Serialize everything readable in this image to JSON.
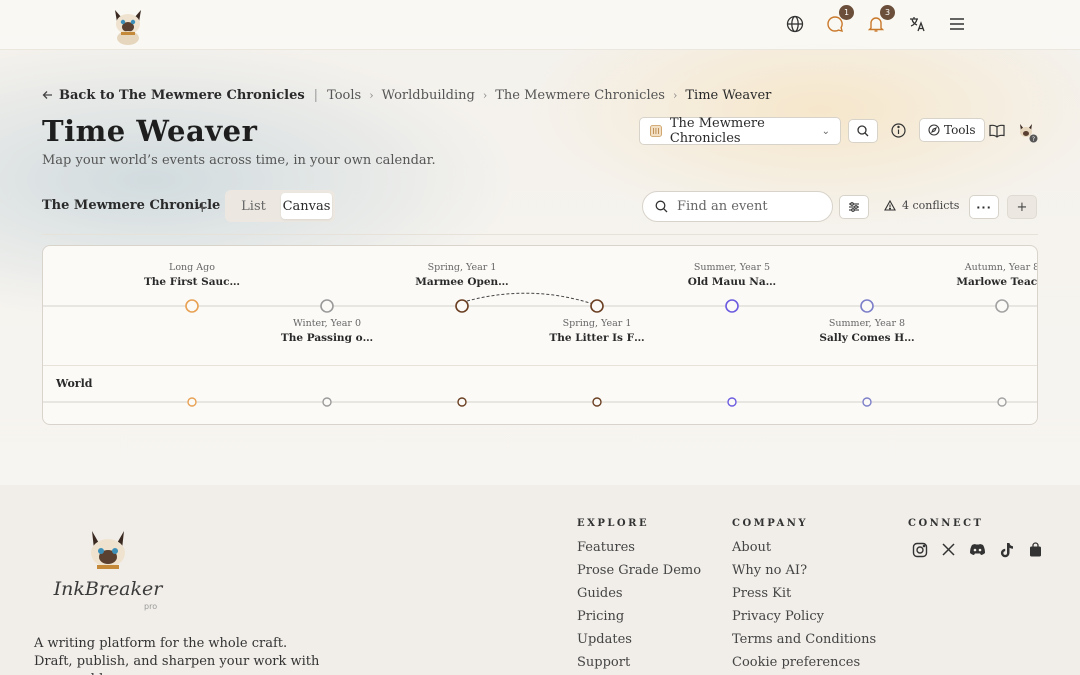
{
  "nav": {
    "messages_badge": "1",
    "notifications_badge": "3"
  },
  "breadcrumb": {
    "back_label": "Back to The Mewmere Chronicles",
    "items": [
      "Tools",
      "Worldbuilding",
      "The Mewmere Chronicles"
    ],
    "current": "Time Weaver"
  },
  "page": {
    "title": "Time Weaver",
    "subtitle": "Map your world’s events across time, in your own calendar."
  },
  "header": {
    "project_select": "The Mewmere Chronicles",
    "tools_label": "Tools"
  },
  "toolbar": {
    "chronicle_name": "The Mewmere Chronicle",
    "views": [
      "List",
      "Canvas"
    ],
    "active_view": "Canvas",
    "search_placeholder": "Find an event",
    "conflicts_label": "4 conflicts"
  },
  "timeline": {
    "lane_label": "World",
    "events": [
      {
        "date": "Long Ago",
        "title": "The First Sauc…",
        "row": "top",
        "color": "#e8a154"
      },
      {
        "date": "Winter, Year 0",
        "title": "The Passing o…",
        "row": "bottom",
        "color": "#9a9a9a"
      },
      {
        "date": "Spring, Year 1",
        "title": "Marmee Open…",
        "row": "top",
        "color": "#6b3f22"
      },
      {
        "date": "Spring, Year 1",
        "title": "The Litter Is F…",
        "row": "bottom",
        "color": "#6b3f22"
      },
      {
        "date": "Summer, Year 5",
        "title": "Old Mauu Na…",
        "row": "top",
        "color": "#6c5ce0"
      },
      {
        "date": "Summer, Year 8",
        "title": "Sally Comes H…",
        "row": "bottom",
        "color": "#7d7fc9"
      },
      {
        "date": "Autumn, Year 8",
        "title": "Marlowe Teac…",
        "row": "top",
        "color": "#a3a3a3"
      }
    ]
  },
  "footer": {
    "description": "A writing platform for the whole craft. Draft, publish, and sharpen your work with measurable",
    "explore": {
      "heading": "EXPLORE",
      "links": [
        "Features",
        "Prose Grade Demo",
        "Guides",
        "Pricing",
        "Updates",
        "Support"
      ]
    },
    "company": {
      "heading": "COMPANY",
      "links": [
        "About",
        "Why no AI?",
        "Press Kit",
        "Privacy Policy",
        "Terms and Conditions",
        "Cookie preferences"
      ]
    },
    "connect": {
      "heading": "CONNECT",
      "icons": [
        "instagram-icon",
        "x-icon",
        "discord-icon",
        "tiktok-icon",
        "shop-icon"
      ]
    }
  }
}
